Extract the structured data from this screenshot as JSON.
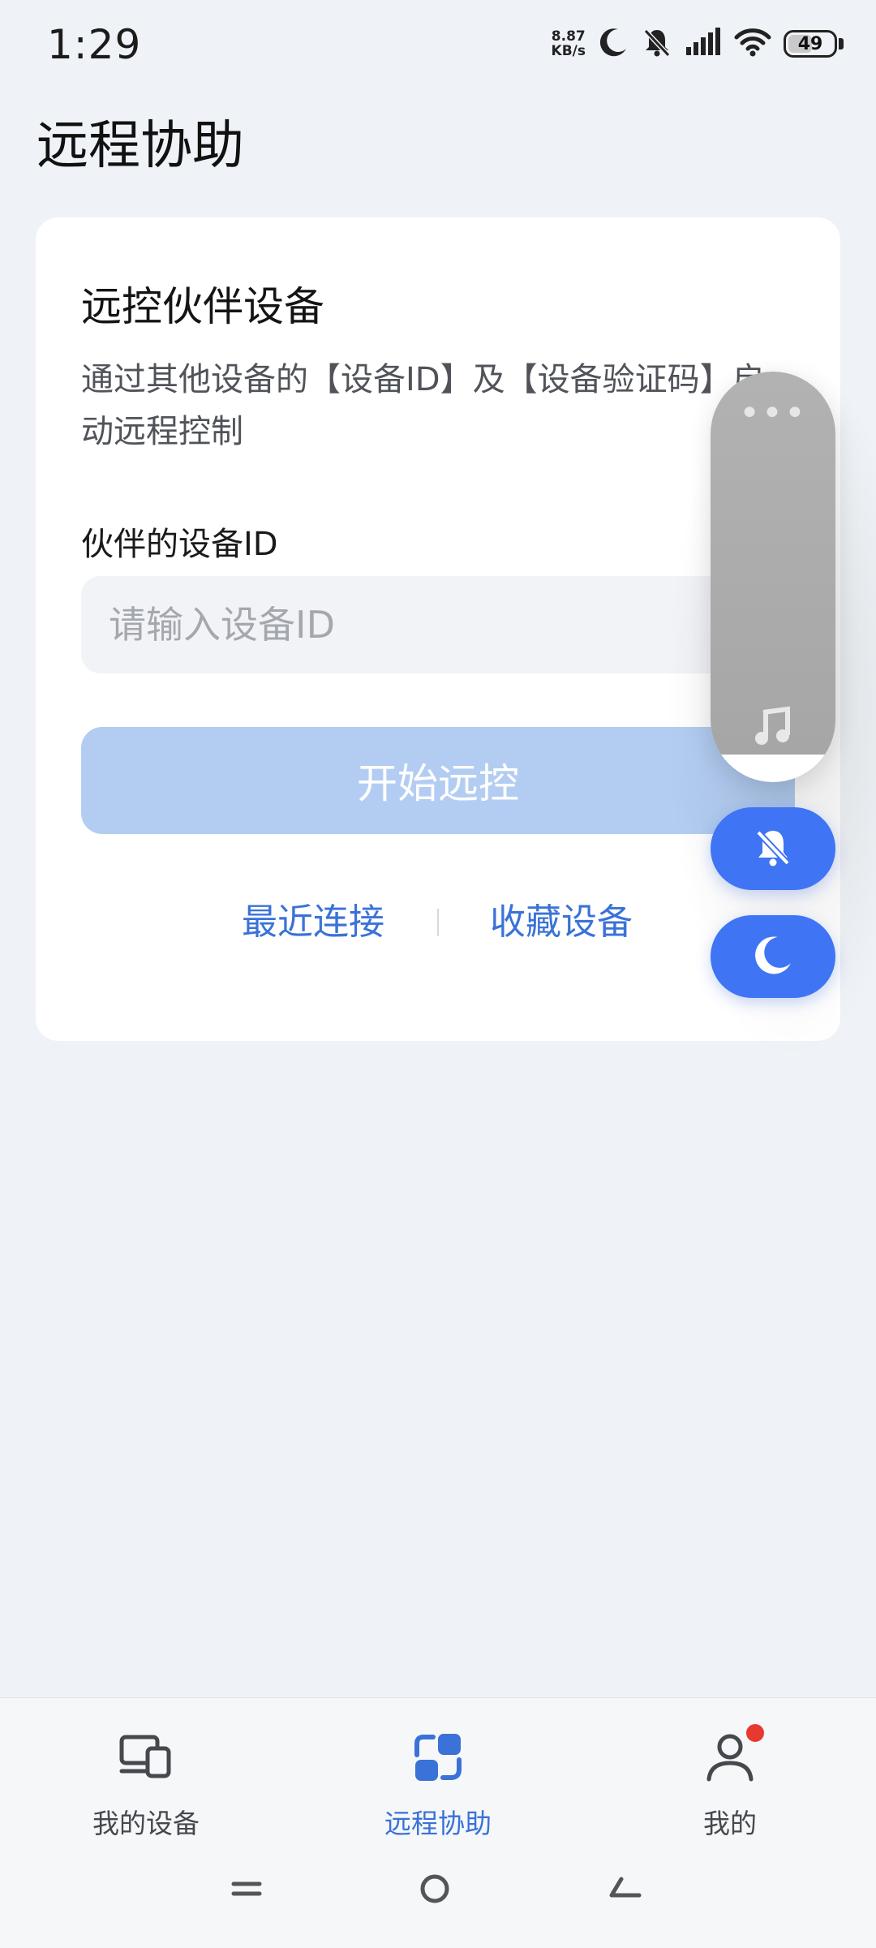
{
  "status_bar": {
    "time": "1:29",
    "net_speed_value": "8.87",
    "net_speed_unit": "KB/s",
    "battery": "49",
    "icons": [
      "moon-icon",
      "bell-off-icon",
      "signal-icon",
      "wifi-icon",
      "battery-icon"
    ]
  },
  "page": {
    "title": "远程协助"
  },
  "card": {
    "title": "远控伙伴设备",
    "description": "通过其他设备的【设备ID】及【设备验证码】启动远程控制",
    "field_label": "伙伴的设备ID",
    "input_value": "",
    "input_placeholder": "请输入设备ID",
    "start_button": "开始远控",
    "links": {
      "recent": "最近连接",
      "favorites": "收藏设备"
    }
  },
  "floating_panel": {
    "icons": [
      "more-icon",
      "music-note-icon",
      "bell-off-icon",
      "moon-icon"
    ]
  },
  "bottom_nav": {
    "items": [
      {
        "label": "我的设备",
        "icon": "devices-icon",
        "active": false
      },
      {
        "label": "远程协助",
        "icon": "remote-assist-icon",
        "active": true
      },
      {
        "label": "我的",
        "icon": "person-icon",
        "active": false,
        "badge": true
      }
    ]
  },
  "colors": {
    "accent": "#3a72d8",
    "button_disabled": "#b3cdf2",
    "floating_button": "#3f74f4",
    "background": "#eff2f6",
    "badge": "#e8392e"
  }
}
